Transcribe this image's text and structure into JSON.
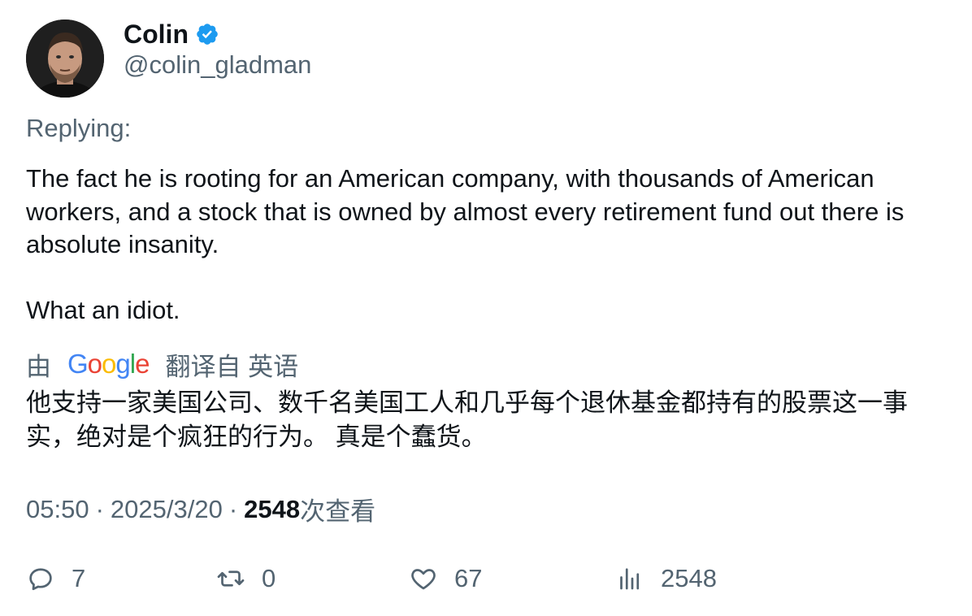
{
  "author": {
    "display_name": "Colin",
    "handle": "@colin_gladman",
    "verified_icon": "verified-badge-icon",
    "avatar_icon": "avatar-photo"
  },
  "replying_label": "Replying:",
  "body": {
    "paragraph_1": "The fact he is rooting for an American company, with thousands of American workers, and a stock that is owned by almost every retirement fund out there is absolute insanity.",
    "paragraph_2": "What an idiot."
  },
  "translation": {
    "prefix": "由",
    "provider": "Google",
    "suffix": "翻译自 英语",
    "text": "他支持一家美国公司、数千名美国工人和几乎每个退休基金都持有的股票这一事实，绝对是个疯狂的行为。 真是个蠢货。"
  },
  "meta": {
    "time": "05:50",
    "separator": "·",
    "date": "2025/3/20",
    "views_count": "2548",
    "views_label": "次查看"
  },
  "actions": {
    "reply_count": "7",
    "retweet_count": "0",
    "like_count": "67",
    "views_count": "2548",
    "icons": [
      "reply-icon",
      "retweet-icon",
      "like-icon",
      "views-icon"
    ]
  },
  "colors": {
    "text_primary": "#0f1419",
    "text_secondary": "#536471",
    "verified_blue": "#1d9bf0"
  }
}
